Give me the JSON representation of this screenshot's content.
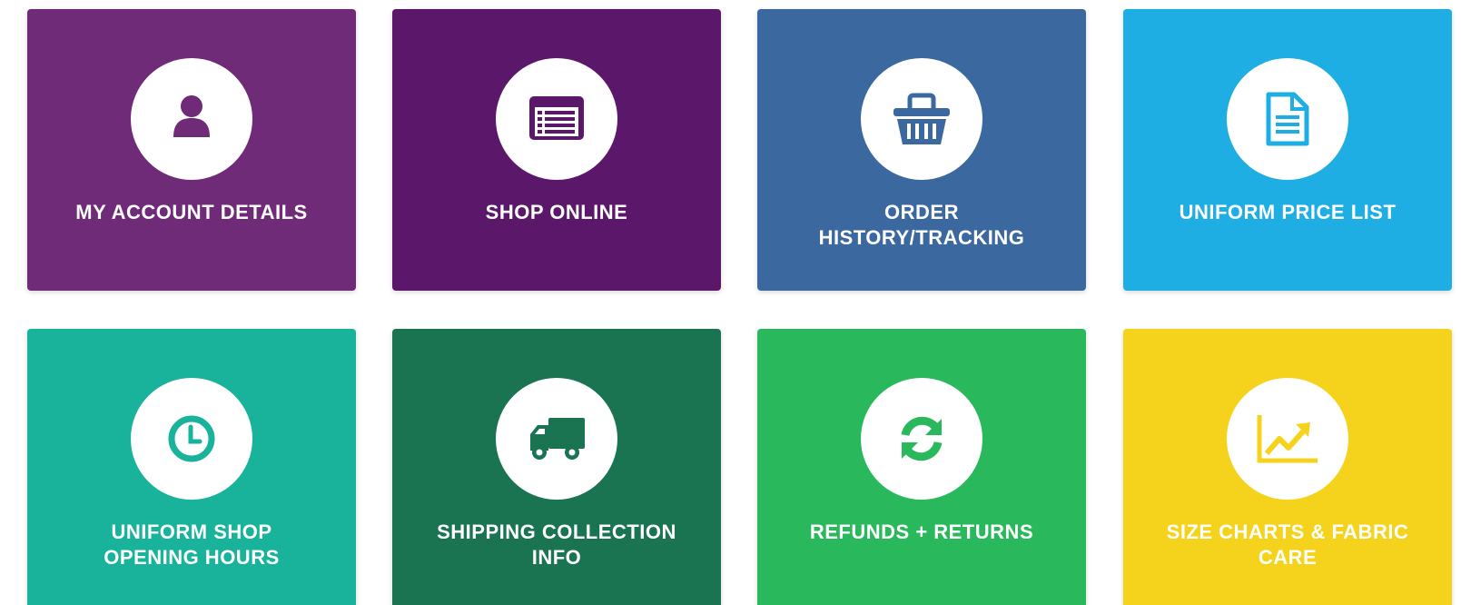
{
  "tiles": [
    {
      "label_lines": [
        "MY ACCOUNT DETAILS"
      ],
      "icon": "user-icon",
      "color": "#6f2a78"
    },
    {
      "label_lines": [
        "SHOP ONLINE"
      ],
      "icon": "product-list-icon",
      "color": "#5b186b"
    },
    {
      "label_lines": [
        "ORDER",
        "HISTORY/TRACKING"
      ],
      "icon": "basket-icon",
      "color": "#3a689f"
    },
    {
      "label_lines": [
        "UNIFORM PRICE LIST"
      ],
      "icon": "document-icon",
      "color": "#1eaee4"
    },
    {
      "label_lines": [
        "UNIFORM SHOP",
        "OPENING HOURS"
      ],
      "icon": "clock-icon",
      "color": "#19b39c"
    },
    {
      "label_lines": [
        "SHIPPING COLLECTION",
        "INFO"
      ],
      "icon": "truck-icon",
      "color": "#1a7351"
    },
    {
      "label_lines": [
        "REFUNDS + RETURNS"
      ],
      "icon": "refresh-icon",
      "color": "#29b95c"
    },
    {
      "label_lines": [
        "SIZE CHARTS & FABRIC",
        "CARE"
      ],
      "icon": "chart-icon",
      "color": "#f5d31c"
    }
  ]
}
